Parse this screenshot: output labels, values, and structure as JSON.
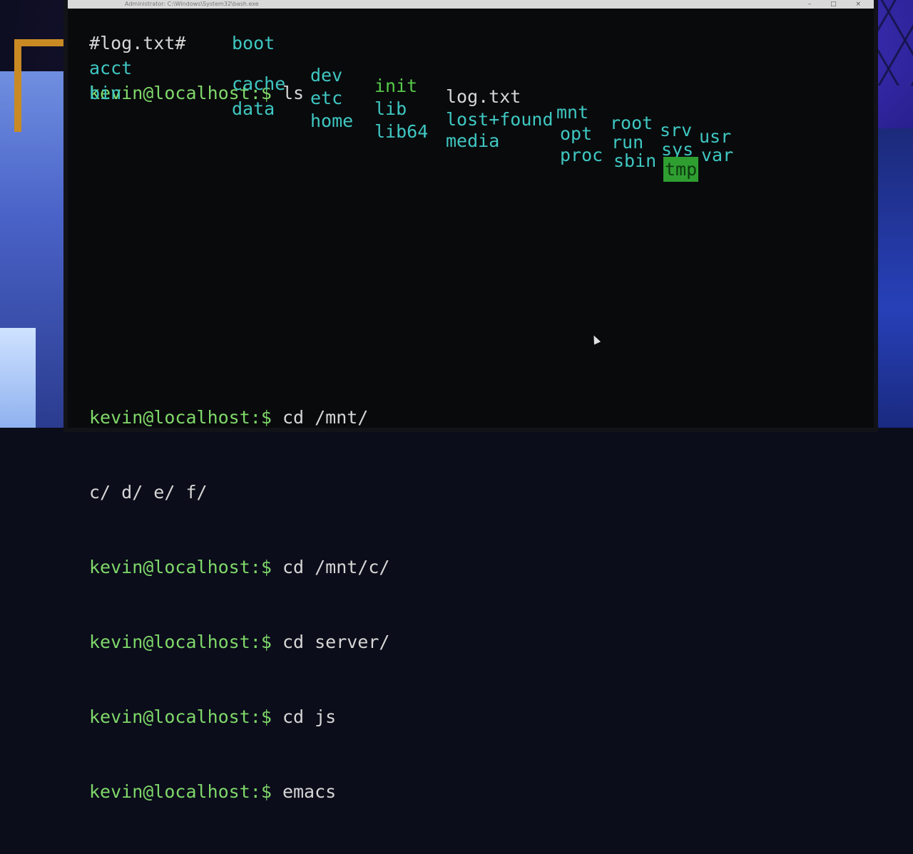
{
  "window": {
    "title": "Administrator: C:\\Windows\\System32\\bash.exe",
    "controls": "– □ ×"
  },
  "session": [
    {
      "prompt": "kevin@localhost:$",
      "command": "ls"
    },
    {
      "prompt": "kevin@localhost:$",
      "command": "cd /mnt/"
    },
    {
      "output": "c/ d/ e/ f/"
    },
    {
      "prompt": "kevin@localhost:$",
      "command": "cd /mnt/c/"
    },
    {
      "prompt": "kevin@localhost:$",
      "command": "cd server/"
    },
    {
      "prompt": "kevin@localhost:$",
      "command": "cd js"
    },
    {
      "prompt": "kevin@localhost:$",
      "command": "emacs"
    }
  ],
  "ls_output": [
    {
      "name": "#log.txt#",
      "kind": "file"
    },
    {
      "name": "boot",
      "kind": "dir"
    },
    {
      "name": "acct",
      "kind": "dir"
    },
    {
      "name": "bin",
      "kind": "dir"
    },
    {
      "name": "cache",
      "kind": "dir"
    },
    {
      "name": "data",
      "kind": "dir"
    },
    {
      "name": "dev",
      "kind": "dir"
    },
    {
      "name": "etc",
      "kind": "dir"
    },
    {
      "name": "home",
      "kind": "dir"
    },
    {
      "name": "init",
      "kind": "exec"
    },
    {
      "name": "lib",
      "kind": "dir"
    },
    {
      "name": "lib64",
      "kind": "dir"
    },
    {
      "name": "log.txt",
      "kind": "file"
    },
    {
      "name": "lost+found",
      "kind": "dir"
    },
    {
      "name": "media",
      "kind": "dir"
    },
    {
      "name": "mnt",
      "kind": "dir"
    },
    {
      "name": "opt",
      "kind": "dir"
    },
    {
      "name": "proc",
      "kind": "dir"
    },
    {
      "name": "root",
      "kind": "dir"
    },
    {
      "name": "run",
      "kind": "dir"
    },
    {
      "name": "sbin",
      "kind": "dir"
    },
    {
      "name": "srv",
      "kind": "dir"
    },
    {
      "name": "sys",
      "kind": "dir"
    },
    {
      "name": "tmp",
      "kind": "sticky"
    },
    {
      "name": "usr",
      "kind": "dir"
    },
    {
      "name": "var",
      "kind": "dir"
    }
  ],
  "colors": {
    "prompt": "#7fd86a",
    "dir": "#3fc7c2",
    "exec": "#56c94a",
    "sticky_bg": "#2f9e31",
    "background": "#090a0c"
  }
}
